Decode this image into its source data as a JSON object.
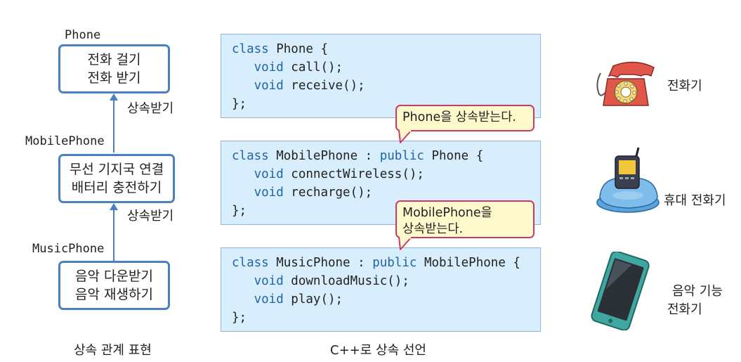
{
  "hierarchy": {
    "phone": {
      "label": "Phone",
      "lines": [
        "전화 걸기",
        "전화 받기"
      ]
    },
    "mobile": {
      "label": "MobilePhone",
      "lines": [
        "무선 기지국 연결",
        "배터리 충전하기"
      ]
    },
    "music": {
      "label": "MusicPhone",
      "lines": [
        "음악 다운받기",
        "음악 재생하기"
      ]
    },
    "inherit_label_1": "상속받기",
    "inherit_label_2": "상속받기",
    "caption": "상속 관계 표현"
  },
  "code": {
    "phone": [
      "class Phone {",
      "void call();",
      "void receive();",
      "};"
    ],
    "mobile": [
      "class MobilePhone : ",
      "public",
      " Phone {",
      "void connectWireless();",
      "void recharge();",
      "};"
    ],
    "music": [
      "class MusicPhone : ",
      "public",
      " MobilePhone {",
      "void downloadMusic();",
      "void play();",
      "};"
    ],
    "class_kw": "class",
    "void_kw": "void",
    "caption": "C++로 상속 선언"
  },
  "bubbles": {
    "b1": "Phone을 상속받는다.",
    "b2_l1": "MobilePhone을",
    "b2_l2": "상속받는다."
  },
  "devices": {
    "d1": "전화기",
    "d2": "휴대 전화기",
    "d3_l1": "음악 기능",
    "d3_l2": "전화기"
  },
  "colors": {
    "box_border": "#4a7fc0",
    "code_bg": "#d8eefc",
    "keyword": "#1f64a8",
    "bubble_border": "#c93a6b",
    "bubble_bg": "#fff9cc"
  }
}
